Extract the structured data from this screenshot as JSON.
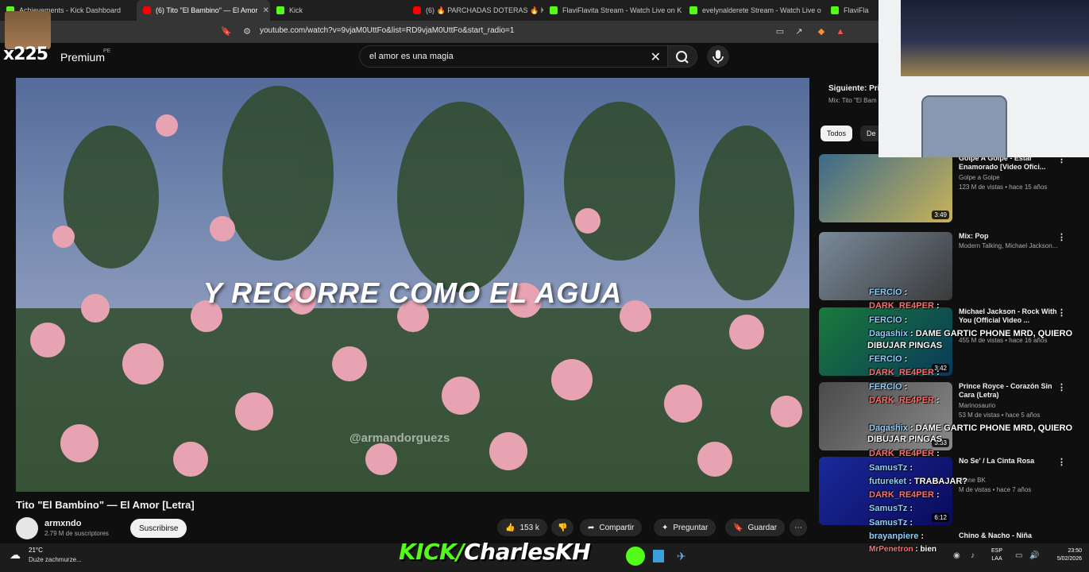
{
  "browser": {
    "tabs": [
      {
        "label": "Achievements - Kick Dashboard",
        "icon": "kick-icon"
      },
      {
        "label": "(6) Tito \"El Bambino\" — El Amor",
        "icon": "youtube-icon",
        "active": true
      },
      {
        "label": "Kick",
        "icon": "kick-icon"
      },
      {
        "label": "(6) 🔥 PARCHADAS DOTERAS 🔥 KIN",
        "icon": "youtube-icon"
      },
      {
        "label": "FlaviFlavita Stream - Watch Live on K",
        "icon": "kick-icon"
      },
      {
        "label": "evelynalderete Stream - Watch Live o",
        "icon": "kick-icon"
      },
      {
        "label": "FlaviFla",
        "icon": "kick-icon"
      }
    ],
    "url": "youtube.com/watch?v=9vjaM0UttFo&list=RD9vjaM0UttFo&start_radio=1"
  },
  "header": {
    "brand": "x225",
    "premium_label": "Premium",
    "region": "PE",
    "search_value": "el amor es una magia"
  },
  "video": {
    "subtitle": "Y RECORRE COMO EL AGUA",
    "watermark": "@armandorguezs",
    "title": "Tito \"El Bambino\" — El Amor [Letra]",
    "channel": "armxndo",
    "subscribers": "2.79 M de suscriptores",
    "subscribe_label": "Suscribirse",
    "likes": "153 k",
    "share_label": "Compartir",
    "ask_label": "Preguntar",
    "save_label": "Guardar"
  },
  "sidebar": {
    "next_label": "Siguiente: Pri",
    "next_mix": "Mix: Tito \"El Bam",
    "chips": [
      "Todos",
      "De"
    ],
    "recommendations": [
      {
        "title": "Golpe A Golpe - Estar Enamorado [Video Ofici...",
        "channel": "Golpe a Golpe",
        "meta": "123 M de vistas • hace 15 años",
        "duration": "3:49"
      },
      {
        "title": "Mix: Pop",
        "channel": "Modern Talking, Michael Jackson...",
        "meta": "",
        "duration": ""
      },
      {
        "title": "Michael Jackson - Rock With You (Official Video ...",
        "channel": "",
        "meta": "455 M de vistas • hace 16 años",
        "duration": "3:42"
      },
      {
        "title": "Prince Royce - Corazón Sin Cara (Letra)",
        "channel": "Marinosaurio",
        "meta": "53 M de vistas • hace 5 años",
        "duration": "3:33"
      },
      {
        "title": "No Se' / La Cinta Rosa",
        "channel": "Clone BK",
        "meta": "M de vistas • hace 7 años",
        "duration": "6:12"
      },
      {
        "title": "Chino & Nacho - Niña",
        "channel": "",
        "meta": "",
        "duration": ""
      }
    ]
  },
  "chat": [
    {
      "nick": "FERCIO",
      "msg": ""
    },
    {
      "nick": "DARK_RE4PER",
      "msg": ""
    },
    {
      "nick": "FERCIO",
      "msg": ""
    },
    {
      "nick": "Dagashix",
      "msg": "DAME GARTIC PHONE MRD, QUIERO"
    },
    {
      "nick": "",
      "msg": "DIBUJAR PINGAS"
    },
    {
      "nick": "FERCIO",
      "msg": ""
    },
    {
      "nick": "DARK_RE4PER",
      "msg": ""
    },
    {
      "nick": "FERCIO",
      "msg": ""
    },
    {
      "nick": "DARK_RE4PER",
      "msg": ""
    },
    {
      "nick": "Dagashix",
      "msg": "DAME GARTIC PHONE MRD, QUIERO"
    },
    {
      "nick": "",
      "msg": "DIBUJAR PINGAS"
    },
    {
      "nick": "DARK_RE4PER",
      "msg": ""
    },
    {
      "nick": "SamusTz",
      "msg": ""
    },
    {
      "nick": "futureket",
      "msg": "TRABAJAR?"
    },
    {
      "nick": "DARK_RE4PER",
      "msg": ""
    },
    {
      "nick": "SamusTz",
      "msg": ""
    },
    {
      "nick": "DARK_RE4PER",
      "msg": ""
    },
    {
      "nick": "SamusTz",
      "msg": ""
    },
    {
      "nick": "brayanpiere",
      "msg": ""
    },
    {
      "nick": "MrPenetron",
      "msg": "bien"
    }
  ],
  "taskbar": {
    "temperature": "21°C",
    "weather": "Duże zachmurze...",
    "kick_prefix": "KICK/",
    "kick_channel": "CharlesKH",
    "lang_top": "ESP",
    "lang_bottom": "LAA",
    "time": "23:50",
    "date": "5/02/2026"
  }
}
